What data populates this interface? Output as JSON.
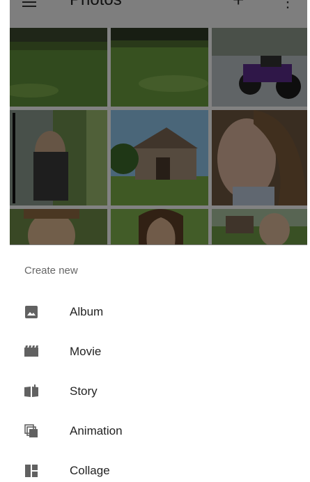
{
  "app_bar": {
    "title": "Photos",
    "add_icon": "plus-icon",
    "more_icon": "more-vert-icon",
    "menu_icon": "hamburger-menu-icon"
  },
  "photos": [
    {
      "name": "lawn-photo"
    },
    {
      "name": "lawn-photo-2"
    },
    {
      "name": "motorcycles-photo"
    },
    {
      "name": "person-photo"
    },
    {
      "name": "stone-building-photo"
    },
    {
      "name": "woman-portrait-photo"
    },
    {
      "name": "boy-portrait-photo"
    },
    {
      "name": "girl-portrait-photo"
    },
    {
      "name": "garden-photo"
    }
  ],
  "sheet": {
    "title": "Create new",
    "items": [
      {
        "label": "Album",
        "icon": "album-icon"
      },
      {
        "label": "Movie",
        "icon": "movie-icon"
      },
      {
        "label": "Story",
        "icon": "story-icon"
      },
      {
        "label": "Animation",
        "icon": "animation-icon"
      },
      {
        "label": "Collage",
        "icon": "collage-icon"
      }
    ]
  },
  "colors": {
    "scrim": "#000000",
    "icon": "#616161",
    "sheet_bg": "#ffffff"
  }
}
